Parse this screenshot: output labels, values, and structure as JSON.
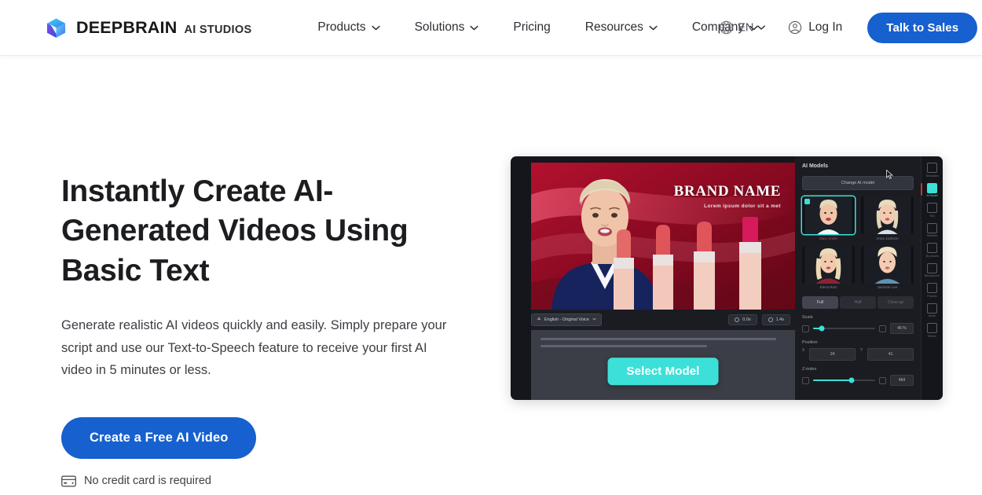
{
  "brand": {
    "name": "DEEPBRAIN",
    "subtitle": "AI STUDIOS",
    "logo_icon": "cube-logo-icon",
    "colors": {
      "primary": "#1660cf",
      "accent": "#3de0d9",
      "text": "#17181a"
    }
  },
  "nav": {
    "links": [
      {
        "label": "Products",
        "has_dropdown": true,
        "icon": "chevron-down-icon"
      },
      {
        "label": "Solutions",
        "has_dropdown": true,
        "icon": "chevron-down-icon"
      },
      {
        "label": "Pricing",
        "has_dropdown": false
      },
      {
        "label": "Resources",
        "has_dropdown": true,
        "icon": "chevron-down-icon"
      },
      {
        "label": "Company",
        "has_dropdown": true,
        "icon": "chevron-down-icon"
      }
    ],
    "language": {
      "label": "EN",
      "icon": "globe-icon",
      "caret": "chevron-down-icon"
    },
    "login": {
      "label": "Log In",
      "icon": "user-circle-icon"
    },
    "cta": {
      "label": "Talk to Sales"
    }
  },
  "hero": {
    "title": "Instantly Create AI-Generated Videos Using Basic Text",
    "description": "Generate realistic AI videos quickly and easily. Simply prepare your script and use our Text-to-Speech feature to receive your first AI video in 5 minutes or less.",
    "cta_label": "Create a Free AI Video",
    "note": "No credit card is required",
    "note_icon": "credit-card-icon"
  },
  "mockup": {
    "video": {
      "brand_name": "BRAND NAME",
      "brand_tagline": "Lorem ipsum dolor sit a met"
    },
    "toolbar": {
      "language_chip": "English - Original Voice",
      "language_icon": "voice-icon",
      "duration_chip": "0.0s",
      "duration_icon": "clock-icon",
      "length_chip": "1.4s",
      "length_icon": "clock-icon"
    },
    "select_model_button": "Select Model",
    "panel": {
      "title": "AI Models",
      "change_button": "Change AI model",
      "models": [
        {
          "name": "Mary Smith",
          "selected": true
        },
        {
          "name": "Anna Jackson",
          "selected": false
        },
        {
          "name": "Elena Ruiz",
          "selected": false
        },
        {
          "name": "Jasmine Lee",
          "selected": false
        }
      ],
      "segments": [
        {
          "label": "Full",
          "active": true
        },
        {
          "label": "Half",
          "active": false
        },
        {
          "label": "Close-up",
          "active": false
        }
      ],
      "controls": [
        {
          "label": "Scale",
          "value": "46 %",
          "fill_pct": 14,
          "icon": "scale-icon"
        },
        {
          "label": "Z-index",
          "value": "464",
          "fill_pct": 62,
          "icon": "layers-icon"
        }
      ],
      "position": {
        "label": "Position",
        "x_axis": "X",
        "x_value": "24",
        "y_axis": "Y",
        "y_value": "41"
      }
    },
    "rail": [
      {
        "label": "Templates",
        "icon": "template-icon",
        "active": false
      },
      {
        "label": "AI Model",
        "icon": "person-icon",
        "active": true
      },
      {
        "label": "Text",
        "icon": "text-icon",
        "active": false
      },
      {
        "label": "Subtitles",
        "icon": "subtitle-icon",
        "active": false
      },
      {
        "label": "My Assets",
        "icon": "image-icon",
        "active": false
      },
      {
        "label": "Background",
        "icon": "background-icon",
        "active": false
      },
      {
        "label": "Frames",
        "icon": "frame-icon",
        "active": false
      },
      {
        "label": "Audio",
        "icon": "audio-icon",
        "active": false
      },
      {
        "label": "Effects",
        "icon": "effects-icon",
        "active": false
      }
    ]
  }
}
